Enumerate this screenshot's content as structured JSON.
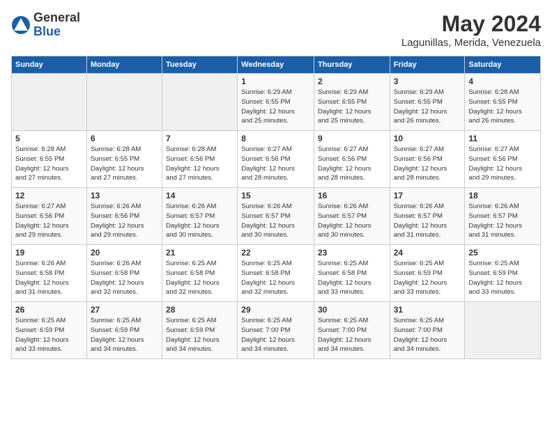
{
  "logo": {
    "general": "General",
    "blue": "Blue"
  },
  "title": "May 2024",
  "location": "Lagunillas, Merida, Venezuela",
  "days_of_week": [
    "Sunday",
    "Monday",
    "Tuesday",
    "Wednesday",
    "Thursday",
    "Friday",
    "Saturday"
  ],
  "weeks": [
    [
      {
        "day": "",
        "info": ""
      },
      {
        "day": "",
        "info": ""
      },
      {
        "day": "",
        "info": ""
      },
      {
        "day": "1",
        "info": "Sunrise: 6:29 AM\nSunset: 6:55 PM\nDaylight: 12 hours\nand 25 minutes."
      },
      {
        "day": "2",
        "info": "Sunrise: 6:29 AM\nSunset: 6:55 PM\nDaylight: 12 hours\nand 25 minutes."
      },
      {
        "day": "3",
        "info": "Sunrise: 6:29 AM\nSunset: 6:55 PM\nDaylight: 12 hours\nand 26 minutes."
      },
      {
        "day": "4",
        "info": "Sunrise: 6:28 AM\nSunset: 6:55 PM\nDaylight: 12 hours\nand 26 minutes."
      }
    ],
    [
      {
        "day": "5",
        "info": "Sunrise: 6:28 AM\nSunset: 6:55 PM\nDaylight: 12 hours\nand 27 minutes."
      },
      {
        "day": "6",
        "info": "Sunrise: 6:28 AM\nSunset: 6:55 PM\nDaylight: 12 hours\nand 27 minutes."
      },
      {
        "day": "7",
        "info": "Sunrise: 6:28 AM\nSunset: 6:56 PM\nDaylight: 12 hours\nand 27 minutes."
      },
      {
        "day": "8",
        "info": "Sunrise: 6:27 AM\nSunset: 6:56 PM\nDaylight: 12 hours\nand 28 minutes."
      },
      {
        "day": "9",
        "info": "Sunrise: 6:27 AM\nSunset: 6:56 PM\nDaylight: 12 hours\nand 28 minutes."
      },
      {
        "day": "10",
        "info": "Sunrise: 6:27 AM\nSunset: 6:56 PM\nDaylight: 12 hours\nand 28 minutes."
      },
      {
        "day": "11",
        "info": "Sunrise: 6:27 AM\nSunset: 6:56 PM\nDaylight: 12 hours\nand 29 minutes."
      }
    ],
    [
      {
        "day": "12",
        "info": "Sunrise: 6:27 AM\nSunset: 6:56 PM\nDaylight: 12 hours\nand 29 minutes."
      },
      {
        "day": "13",
        "info": "Sunrise: 6:26 AM\nSunset: 6:56 PM\nDaylight: 12 hours\nand 29 minutes."
      },
      {
        "day": "14",
        "info": "Sunrise: 6:26 AM\nSunset: 6:57 PM\nDaylight: 12 hours\nand 30 minutes."
      },
      {
        "day": "15",
        "info": "Sunrise: 6:26 AM\nSunset: 6:57 PM\nDaylight: 12 hours\nand 30 minutes."
      },
      {
        "day": "16",
        "info": "Sunrise: 6:26 AM\nSunset: 6:57 PM\nDaylight: 12 hours\nand 30 minutes."
      },
      {
        "day": "17",
        "info": "Sunrise: 6:26 AM\nSunset: 6:57 PM\nDaylight: 12 hours\nand 31 minutes."
      },
      {
        "day": "18",
        "info": "Sunrise: 6:26 AM\nSunset: 6:57 PM\nDaylight: 12 hours\nand 31 minutes."
      }
    ],
    [
      {
        "day": "19",
        "info": "Sunrise: 6:26 AM\nSunset: 6:58 PM\nDaylight: 12 hours\nand 31 minutes."
      },
      {
        "day": "20",
        "info": "Sunrise: 6:26 AM\nSunset: 6:58 PM\nDaylight: 12 hours\nand 32 minutes."
      },
      {
        "day": "21",
        "info": "Sunrise: 6:25 AM\nSunset: 6:58 PM\nDaylight: 12 hours\nand 32 minutes."
      },
      {
        "day": "22",
        "info": "Sunrise: 6:25 AM\nSunset: 6:58 PM\nDaylight: 12 hours\nand 32 minutes."
      },
      {
        "day": "23",
        "info": "Sunrise: 6:25 AM\nSunset: 6:58 PM\nDaylight: 12 hours\nand 33 minutes."
      },
      {
        "day": "24",
        "info": "Sunrise: 6:25 AM\nSunset: 6:59 PM\nDaylight: 12 hours\nand 33 minutes."
      },
      {
        "day": "25",
        "info": "Sunrise: 6:25 AM\nSunset: 6:59 PM\nDaylight: 12 hours\nand 33 minutes."
      }
    ],
    [
      {
        "day": "26",
        "info": "Sunrise: 6:25 AM\nSunset: 6:59 PM\nDaylight: 12 hours\nand 33 minutes."
      },
      {
        "day": "27",
        "info": "Sunrise: 6:25 AM\nSunset: 6:59 PM\nDaylight: 12 hours\nand 34 minutes."
      },
      {
        "day": "28",
        "info": "Sunrise: 6:25 AM\nSunset: 6:59 PM\nDaylight: 12 hours\nand 34 minutes."
      },
      {
        "day": "29",
        "info": "Sunrise: 6:25 AM\nSunset: 7:00 PM\nDaylight: 12 hours\nand 34 minutes."
      },
      {
        "day": "30",
        "info": "Sunrise: 6:25 AM\nSunset: 7:00 PM\nDaylight: 12 hours\nand 34 minutes."
      },
      {
        "day": "31",
        "info": "Sunrise: 6:25 AM\nSunset: 7:00 PM\nDaylight: 12 hours\nand 34 minutes."
      },
      {
        "day": "",
        "info": ""
      }
    ]
  ]
}
